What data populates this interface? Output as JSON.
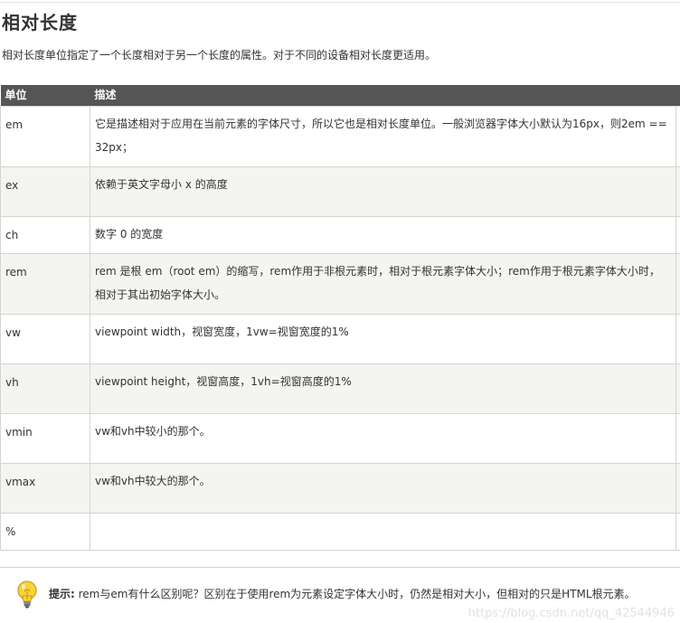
{
  "section": {
    "title": "相对长度",
    "intro": "相对长度单位指定了一个长度相对于另一个长度的属性。对于不同的设备相对长度更适用。"
  },
  "table": {
    "headers": [
      "单位",
      "描述"
    ],
    "rows": [
      {
        "unit": "em",
        "desc": "它是描述相对于应用在当前元素的字体尺寸，所以它也是相对长度单位。一般浏览器字体大小默认为16px，则2em == 32px；"
      },
      {
        "unit": "ex",
        "desc": "依赖于英文字母小 x 的高度"
      },
      {
        "unit": "ch",
        "desc": "数字 0 的宽度"
      },
      {
        "unit": "rem",
        "desc": "rem 是根 em（root em）的缩写，rem作用于非根元素时，相对于根元素字体大小；rem作用于根元素字体大小时，相对于其出初始字体大小。"
      },
      {
        "unit": "vw",
        "desc": "viewpoint width，视窗宽度，1vw=视窗宽度的1%"
      },
      {
        "unit": "vh",
        "desc": "viewpoint height，视窗高度，1vh=视窗高度的1%"
      },
      {
        "unit": "vmin",
        "desc": "vw和vh中较小的那个。"
      },
      {
        "unit": "vmax",
        "desc": "vw和vh中较大的那个。"
      },
      {
        "unit": "%",
        "desc": ""
      }
    ]
  },
  "tip": {
    "icon": "lightbulb-icon",
    "label": "提示:",
    "text": " rem与em有什么区别呢？区别在于使用rem为元素设定字体大小时，仍然是相对大小，但相对的只是HTML根元素。"
  },
  "watermark": "https://blog.csdn.net/qq_42544946"
}
